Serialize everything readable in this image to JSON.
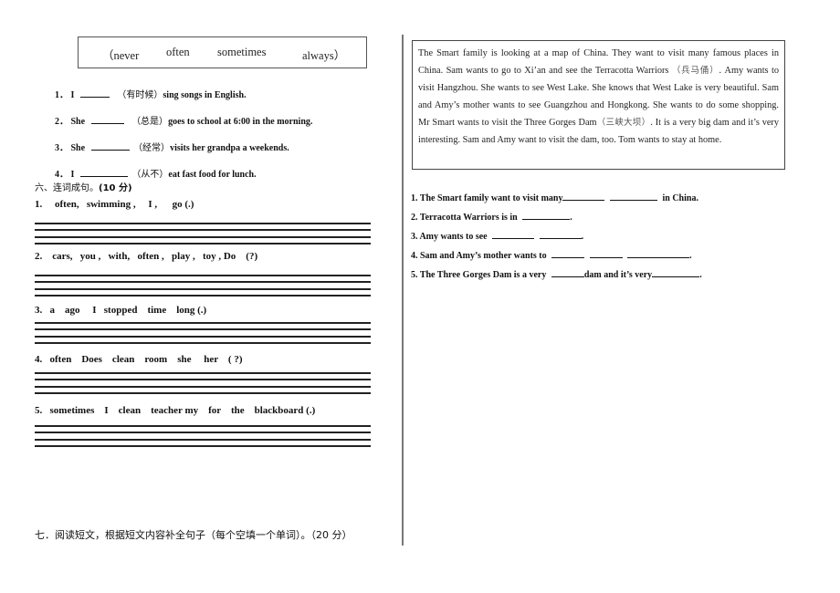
{
  "word_box": {
    "words": [
      "（never",
      "often",
      "sometimes",
      "always）"
    ]
  },
  "fill_in": [
    {
      "num": "1．",
      "subject": "I",
      "hint": "（有时候）",
      "rest": "sing songs in English."
    },
    {
      "num": "2．",
      "subject": "She",
      "hint": "（总是）",
      "rest": "goes to school at 6:00 in the morning."
    },
    {
      "num": "3．",
      "subject": "She",
      "hint": "（经常）",
      "rest": "visits her grandpa a weekends."
    },
    {
      "num": "4．",
      "subject": "I",
      "hint": "（从不）",
      "rest": "eat fast food for lunch."
    }
  ],
  "section6": {
    "title": "六、连词成句。",
    "score": "(10 分)"
  },
  "word_order": [
    {
      "num": "1.",
      "words": "often,   swimming ,     I ,      go (.)"
    },
    {
      "num": "2.",
      "words": "cars,   you ,   with,   often ,   play ,   toy , Do    (?)"
    },
    {
      "num": "3.",
      "words": "a    ago     I   stopped    time    long (.)"
    },
    {
      "num": "4.",
      "words": "often    Does    clean    room    she     her    ( ?)"
    },
    {
      "num": "5.",
      "words": "sometimes    I    clean    teacher my    for    the    blackboard (.)"
    }
  ],
  "passage": {
    "p1": "The Smart family is looking at a map of China. They want to visit many famous places in China. Sam wants to go to Xi’an and see the Terracotta Warriors ",
    "cn1": "（兵马俑）",
    "p2": ". Amy wants to visit Hangzhou. She wants to see West Lake. She knows that West Lake is very beautiful. Sam and Amy’s mother wants to see Guangzhou and Hongkong. She wants to do some shopping. Mr Smart wants to visit the Three Gorges Dam",
    "cn2": "（三峡大坝）",
    "p3": ". It is a very big dam and it’s very interesting. Sam and Amy want to visit the dam, too. Tom wants to stay at home."
  },
  "reading_questions": {
    "q1": {
      "a": "1. The Smart family want to visit many",
      "b": "in China."
    },
    "q2": {
      "a": "2. Terracotta Warriors is in",
      "b": "."
    },
    "q3": {
      "a": "3. Amy wants to see",
      "b": "."
    },
    "q4": {
      "a": "4. Sam and Amy’s mother wants to",
      "b": "."
    },
    "q5": {
      "a": "5. The Three Gorges Dam is a very",
      "b": "dam and it’s very",
      "c": "."
    }
  },
  "section7": {
    "title": "七．阅读短文，根据短文内容补全句子（每个空填一个单词）。（20 分）"
  }
}
